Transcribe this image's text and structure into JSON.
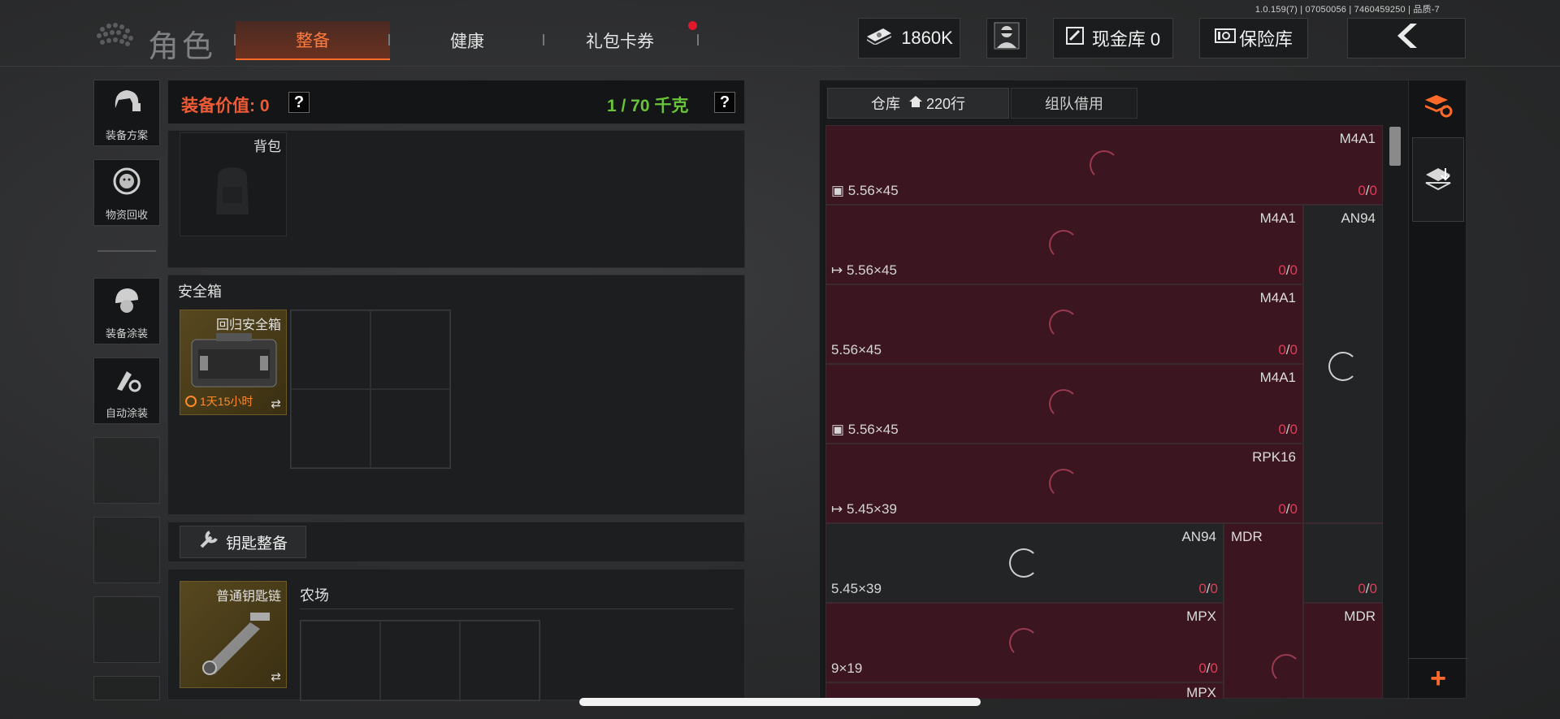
{
  "version": "1.0.159(7) | 07050056 | 7460459250 | 品质-7",
  "header": {
    "title": "角色",
    "tabs": [
      {
        "label": "整备",
        "active": true
      },
      {
        "label": "健康",
        "active": false
      },
      {
        "label": "礼包卡券",
        "active": false,
        "badge": true
      }
    ],
    "currency": "1860K",
    "cash_vault": "现金库 0",
    "safe_vault": "保险库"
  },
  "sidebar": [
    {
      "label": "装备方案",
      "icon": "helmet-gear-icon"
    },
    {
      "label": "物资回收",
      "icon": "recycle-face-icon"
    },
    {
      "label": "装备涂装",
      "icon": "helmet-paint-icon"
    },
    {
      "label": "自动涂装",
      "icon": "brush-gear-icon"
    }
  ],
  "equipment": {
    "value_label": "装备价值: 0",
    "help": "?",
    "weight": "1 / 70 千克",
    "backpack_label": "背包",
    "safebox_section": "安全箱",
    "safebox_item": "回归安全箱",
    "safebox_timer": "1天15小时",
    "key_button": "钥匙整备",
    "keychain_item": "普通钥匙链",
    "keychain_location": "农场"
  },
  "warehouse": {
    "tab_label": "仓库",
    "rows": "220行",
    "team_tab": "组队借用",
    "items": [
      {
        "name": "M4A1",
        "caliber": "5.56×45",
        "count": "0",
        "total": "0",
        "tag": "box"
      },
      {
        "name": "M4A1",
        "caliber": "5.56×45",
        "count": "0",
        "total": "0",
        "tag": "out"
      },
      {
        "name": "AN94",
        "caliber": "",
        "count": "",
        "total": "",
        "tag": ""
      },
      {
        "name": "M4A1",
        "caliber": "5.56×45",
        "count": "0",
        "total": "0",
        "tag": ""
      },
      {
        "name": "M4A1",
        "caliber": "5.56×45",
        "count": "0",
        "total": "0",
        "tag": "box"
      },
      {
        "name": "RPK16",
        "caliber": "5.45×39",
        "count": "0",
        "total": "0",
        "tag": "out"
      },
      {
        "name": "AN94",
        "caliber": "5.45×39",
        "count": "0",
        "total": "0",
        "tag": ""
      },
      {
        "name": "MDR",
        "caliber": "",
        "count": "0",
        "total": "0",
        "tag": ""
      },
      {
        "name": "MPX",
        "caliber": "9×19",
        "count": "0",
        "total": "0",
        "tag": ""
      },
      {
        "name": "MDR",
        "caliber": "",
        "count": "",
        "total": "",
        "tag": ""
      },
      {
        "name": "MPX",
        "caliber": "",
        "count": "",
        "total": "",
        "tag": ""
      }
    ]
  },
  "colors": {
    "accent": "#ff6a2a",
    "weight_green": "#6ac43a",
    "cell_red": "#3b1620",
    "count_red": "#e63a55"
  }
}
